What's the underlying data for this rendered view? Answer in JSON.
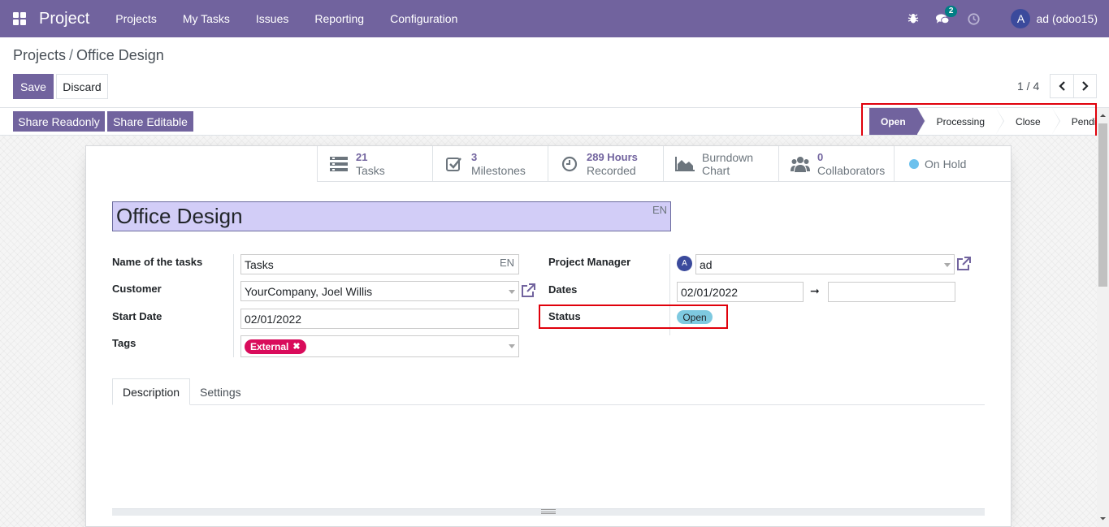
{
  "navbar": {
    "app_name": "Project",
    "menu": [
      "Projects",
      "My Tasks",
      "Issues",
      "Reporting",
      "Configuration"
    ],
    "messages_count": "2",
    "avatar_letter": "A",
    "user_name": "ad (odoo15)"
  },
  "breadcrumb": {
    "parent": "Projects",
    "separator": "/",
    "current": "Office Design"
  },
  "actions": {
    "save": "Save",
    "discard": "Discard"
  },
  "pager": {
    "value": "1 / 4"
  },
  "header_buttons": {
    "share_readonly": "Share Readonly",
    "share_editable": "Share Editable"
  },
  "stages": [
    {
      "label": "Open",
      "active": true
    },
    {
      "label": "Processing",
      "active": false
    },
    {
      "label": "Close",
      "active": false
    },
    {
      "label": "Pending",
      "active": false
    }
  ],
  "stat_buttons": {
    "tasks": {
      "num": "21",
      "label": "Tasks"
    },
    "milestones": {
      "num": "3",
      "label": "Milestones"
    },
    "hours": {
      "num": "289 Hours",
      "label": "Recorded"
    },
    "burndown": {
      "num": "Burndown",
      "label": "Chart"
    },
    "collaborators": {
      "num": "0",
      "label": "Collaborators"
    },
    "onhold": {
      "label": "On Hold",
      "dot_color": "#6cc1ed"
    }
  },
  "form": {
    "title": "Office Design",
    "lang": "EN",
    "labels": {
      "tasks_name": "Name of the tasks",
      "customer": "Customer",
      "start_date": "Start Date",
      "tags": "Tags",
      "project_manager": "Project Manager",
      "dates": "Dates",
      "status": "Status"
    },
    "values": {
      "tasks_name": "Tasks",
      "tasks_name_lang": "EN",
      "customer": "YourCompany, Joel Willis",
      "start_date": "02/01/2022",
      "tag": "External",
      "tag_remove": "✖",
      "project_manager_avatar": "A",
      "project_manager": "ad",
      "date_start": "02/01/2022",
      "date_arrow": "➞",
      "date_end": "",
      "status": "Open"
    }
  },
  "tabs": [
    "Description",
    "Settings"
  ],
  "colors": {
    "brand": "#71639e",
    "highlight_box": "#e0000b",
    "tag": "#d90c5b",
    "status_pill": "#7ec9e0",
    "title_bg": "#d2cdf7"
  }
}
